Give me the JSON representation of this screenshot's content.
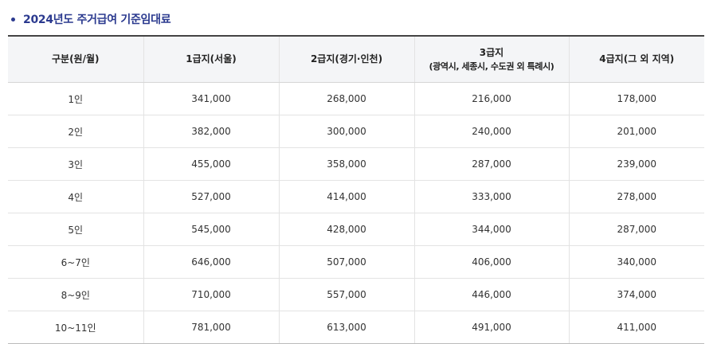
{
  "title": "2024년도 주거급여 기준임대료",
  "table": {
    "headers": [
      {
        "label": "구분(원/월)",
        "sub": ""
      },
      {
        "label": "1급지(서울)",
        "sub": ""
      },
      {
        "label": "2급지(경기·인천)",
        "sub": ""
      },
      {
        "label": "3급지",
        "sub": "(광역시, 세종시, 수도권 외 특례시)"
      },
      {
        "label": "4급지(그 외 지역)",
        "sub": ""
      }
    ],
    "rows": [
      [
        "1인",
        "341,000",
        "268,000",
        "216,000",
        "178,000"
      ],
      [
        "2인",
        "382,000",
        "300,000",
        "240,000",
        "201,000"
      ],
      [
        "3인",
        "455,000",
        "358,000",
        "287,000",
        "239,000"
      ],
      [
        "4인",
        "527,000",
        "414,000",
        "333,000",
        "278,000"
      ],
      [
        "5인",
        "545,000",
        "428,000",
        "344,000",
        "287,000"
      ],
      [
        "6~7인",
        "646,000",
        "507,000",
        "406,000",
        "340,000"
      ],
      [
        "8~9인",
        "710,000",
        "557,000",
        "446,000",
        "374,000"
      ],
      [
        "10~11인",
        "781,000",
        "613,000",
        "491,000",
        "411,000"
      ]
    ]
  },
  "colors": {
    "title": "#2b3a8f",
    "header_bg": "#f4f5f7",
    "top_border": "#444444"
  }
}
